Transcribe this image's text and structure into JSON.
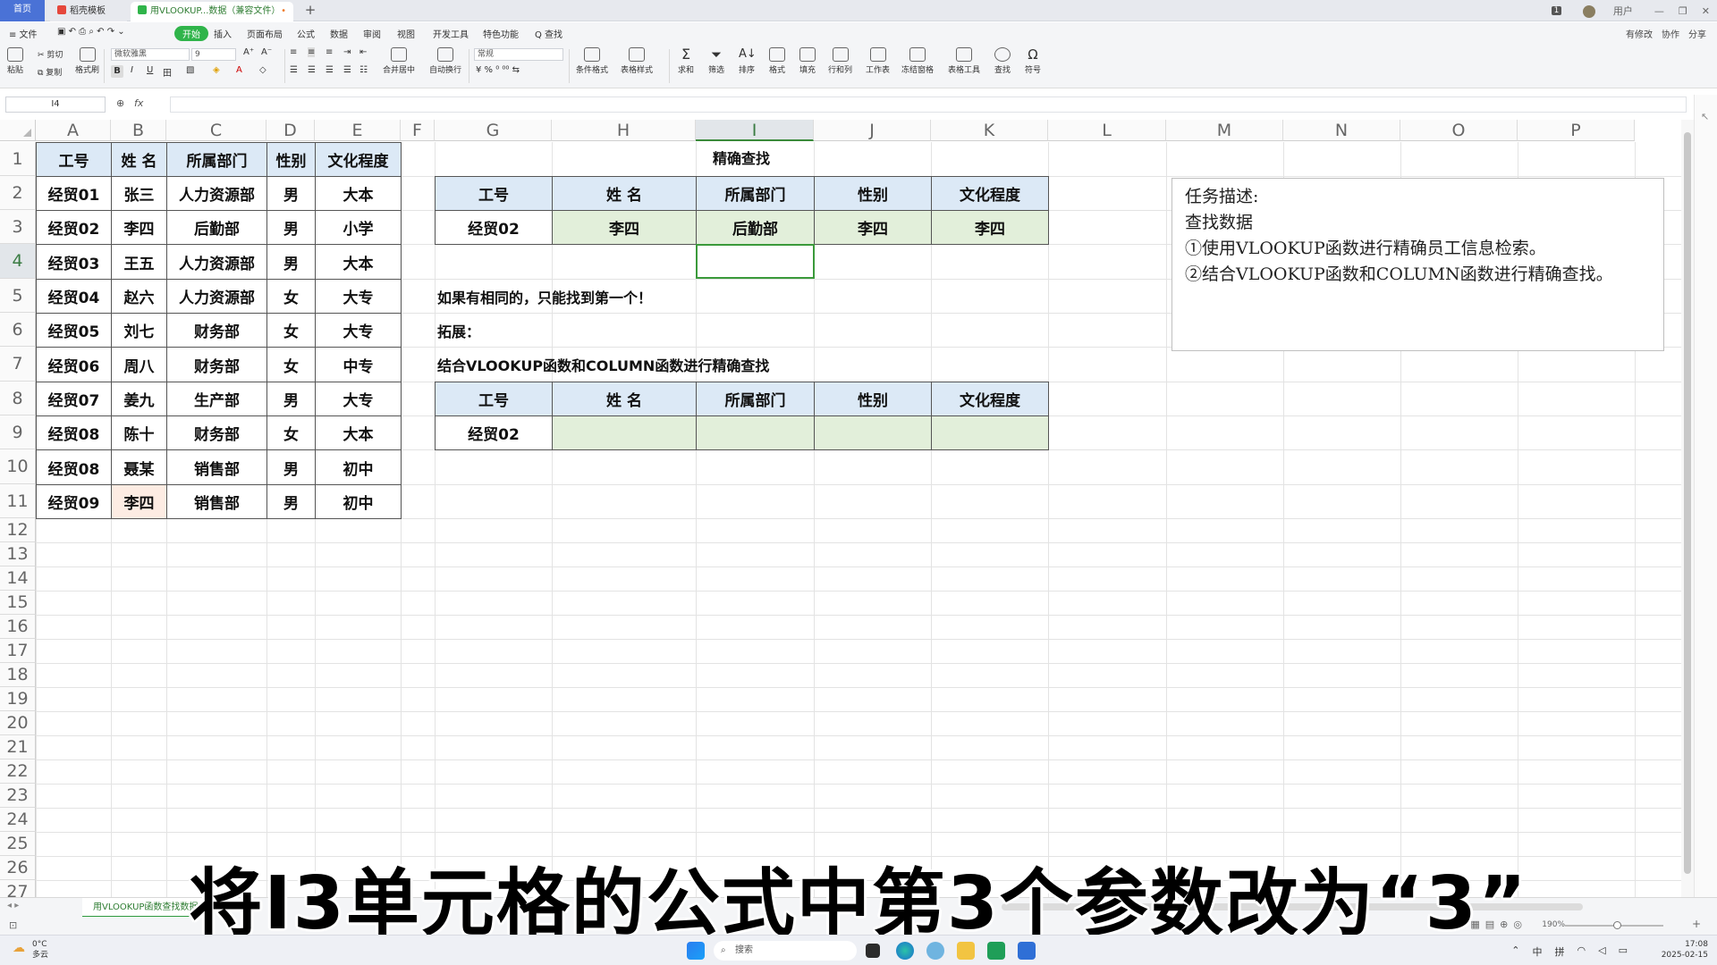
{
  "tabs": {
    "home": "首页",
    "tab2": "稻壳模板",
    "tab3": "用VLOOKUP...数据（兼容文件）",
    "new_tab": "+"
  },
  "title_right": {
    "badge": "1",
    "user": "用户"
  },
  "menu": {
    "file": "≡ 文件",
    "items": [
      "开始",
      "插入",
      "页面布局",
      "公式",
      "数据",
      "审阅",
      "视图",
      "开发工具",
      "特色功能",
      "Q 查找"
    ],
    "right": [
      "有修改",
      "协作",
      "分享"
    ]
  },
  "ribbon": {
    "paste": "粘贴",
    "cut": "剪切",
    "copy": "复制",
    "format_painter": "格式刷",
    "font": "微软雅黑",
    "font_size": "9",
    "merge": "合并居中",
    "wrap": "自动换行",
    "number_format": "常规",
    "cond_format": "条件格式",
    "table_style": "表格样式",
    "sum": "求和",
    "filter": "筛选",
    "sort": "排序",
    "format": "格式",
    "fill": "填充",
    "rowcol": "行和列",
    "sheet": "工作表",
    "freeze": "冻结窗格",
    "tools": "表格工具",
    "find": "查找",
    "symbol": "符号"
  },
  "formula_bar": {
    "name_box": "I4",
    "fx": "fx",
    "formula": ""
  },
  "columns": [
    "A",
    "B",
    "C",
    "D",
    "E",
    "F",
    "G",
    "H",
    "I",
    "J",
    "K",
    "L",
    "M",
    "N",
    "O",
    "P"
  ],
  "rows": [
    "1",
    "2",
    "3",
    "4",
    "5",
    "6",
    "7",
    "8",
    "9",
    "10",
    "11",
    "12",
    "13",
    "14",
    "15",
    "16",
    "17",
    "18",
    "19",
    "20",
    "21",
    "22",
    "23",
    "24",
    "25",
    "26",
    "27"
  ],
  "table_left": {
    "headers": [
      "工号",
      "姓 名",
      "所属部门",
      "性别",
      "文化程度"
    ],
    "rows": [
      [
        "经贸01",
        "张三",
        "人力资源部",
        "男",
        "大本"
      ],
      [
        "经贸02",
        "李四",
        "后勤部",
        "男",
        "小学"
      ],
      [
        "经贸03",
        "王五",
        "人力资源部",
        "男",
        "大本"
      ],
      [
        "经贸04",
        "赵六",
        "人力资源部",
        "女",
        "大专"
      ],
      [
        "经贸05",
        "刘七",
        "财务部",
        "女",
        "大专"
      ],
      [
        "经贸06",
        "周八",
        "财务部",
        "女",
        "中专"
      ],
      [
        "经贸07",
        "姜九",
        "生产部",
        "男",
        "大专"
      ],
      [
        "经贸08",
        "陈十",
        "财务部",
        "女",
        "大本"
      ],
      [
        "经贸08",
        "聂某",
        "销售部",
        "男",
        "初中"
      ],
      [
        "经贸09",
        "李四",
        "销售部",
        "男",
        "初中"
      ]
    ]
  },
  "lookup": {
    "title": "精确查找",
    "headers": [
      "工号",
      "姓 名",
      "所属部门",
      "性别",
      "文化程度"
    ],
    "row": [
      "经贸02",
      "李四",
      "后勤部",
      "李四",
      "李四"
    ]
  },
  "notes": {
    "n5": "如果有相同的，只能找到第一个！",
    "n6": "拓展：",
    "n7": "结合VLOOKUP函数和COLUMN函数进行精确查找"
  },
  "lookup2": {
    "headers": [
      "工号",
      "姓 名",
      "所属部门",
      "性别",
      "文化程度"
    ],
    "row": [
      "经贸02",
      "",
      "",
      "",
      ""
    ]
  },
  "task": {
    "line1": "任务描述:",
    "line2": "查找数据",
    "line3": "①使用VLOOKUP函数进行精确员工信息检索。",
    "line4": "②结合VLOOKUP函数和COLUMN函数进行精确查找。"
  },
  "sheet_tab": "用VLOOKUP函数查找数据",
  "status": {
    "zoom": "190%"
  },
  "subtitle": "将I3单元格的公式中第3个参数改为“3”",
  "taskbar": {
    "weather_temp": "0°C",
    "weather_desc": "多云",
    "search": "搜索",
    "ime1": "中",
    "ime2": "拼",
    "time": "17:08",
    "date": "2025-02-15"
  },
  "colors": {
    "header_fill": "#dce9f6",
    "result_fill": "#e2efda",
    "highlight": "#fdece3",
    "accent": "#2fb44a"
  }
}
